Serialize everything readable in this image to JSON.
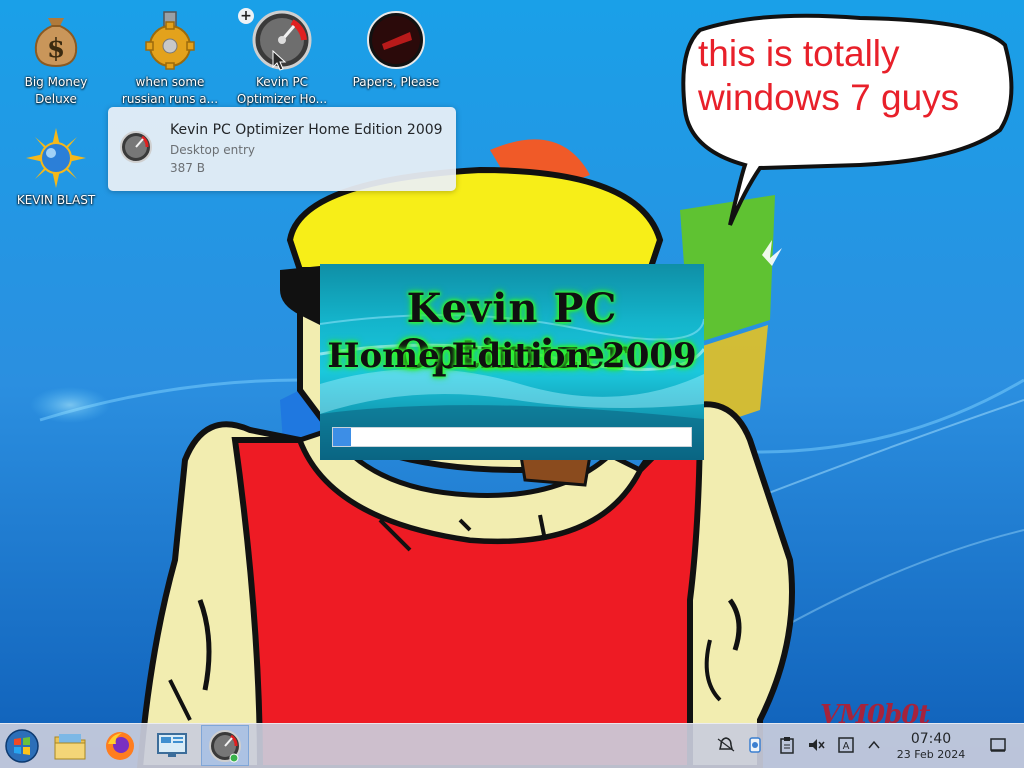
{
  "desktop": {
    "icons": [
      {
        "label": "Big Money Deluxe",
        "icon": "money-bag-icon"
      },
      {
        "label": "when some russian runs a...",
        "icon": "gear-icon"
      },
      {
        "label": "Kevin PC Optimizer Ho...",
        "icon": "gauge-icon"
      },
      {
        "label": "Papers, Please",
        "icon": "papers-please-icon"
      },
      {
        "label": "KEVIN BLAST",
        "icon": "sun-globe-icon"
      }
    ]
  },
  "tooltip": {
    "title": "Kevin PC Optimizer Home Edition 2009",
    "type": "Desktop entry",
    "size": "387 B"
  },
  "bubble": {
    "line1": "this is totally",
    "line2": "windows 7 guys"
  },
  "splash": {
    "title_line1": "Kevin PC Optimizer",
    "title_line2": "Home Edition 2009",
    "progress_percent": 5
  },
  "taskbar": {
    "items": [
      {
        "name": "start-menu",
        "icon": "windows-orb-icon"
      },
      {
        "name": "file-manager",
        "icon": "folder-icon"
      },
      {
        "name": "firefox",
        "icon": "firefox-icon"
      },
      {
        "name": "remote-desktop",
        "icon": "monitor-icon"
      },
      {
        "name": "kevin-pc-optimizer",
        "icon": "gauge-icon",
        "active": true
      }
    ],
    "tray": [
      "notifications-icon",
      "updates-icon",
      "clipboard-icon",
      "volume-muted-icon",
      "keyboard-layout-icon",
      "expand-tray-icon"
    ],
    "clock_time": "07:40",
    "clock_date": "23 Feb 2024"
  },
  "colors": {
    "bubble_text": "#e8202a",
    "splash_glow": "#34ff29",
    "progress_fill": "#3d8ee6"
  }
}
